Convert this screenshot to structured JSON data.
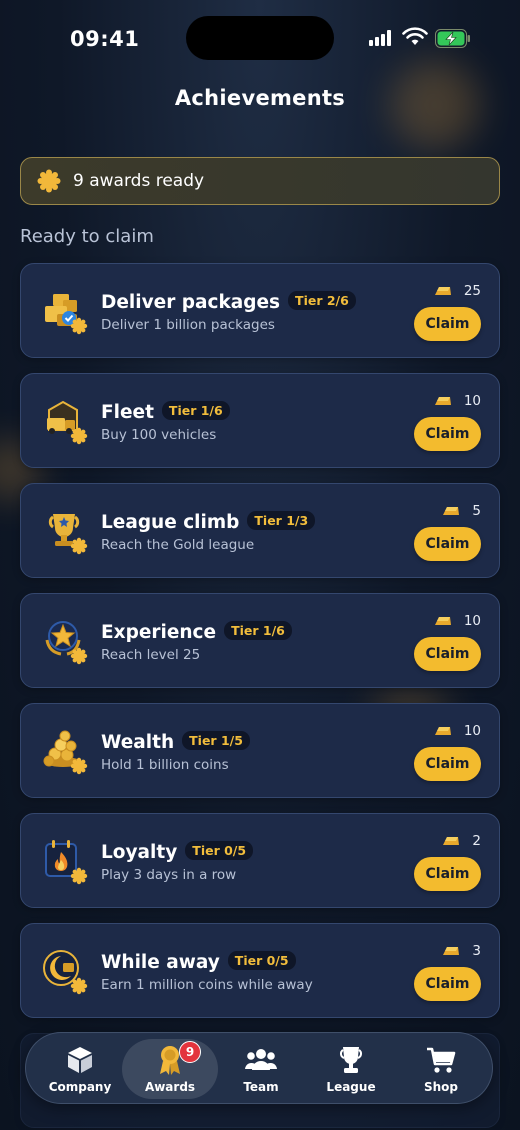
{
  "status_bar": {
    "time": "09:41"
  },
  "header": {
    "title": "Achievements"
  },
  "banner": {
    "text": "9 awards ready"
  },
  "section": {
    "title": "Ready to claim"
  },
  "achievements": [
    {
      "title": "Deliver packages",
      "tier": "Tier 2/6",
      "subtitle": "Deliver 1 billion packages",
      "reward": "25",
      "claim": "Claim",
      "icon": "packages-icon"
    },
    {
      "title": "Fleet",
      "tier": "Tier 1/6",
      "subtitle": "Buy 100 vehicles",
      "reward": "10",
      "claim": "Claim",
      "icon": "truck-icon"
    },
    {
      "title": "League climb",
      "tier": "Tier 1/3",
      "subtitle": "Reach the Gold league",
      "reward": "5",
      "claim": "Claim",
      "icon": "trophy-icon"
    },
    {
      "title": "Experience",
      "tier": "Tier 1/6",
      "subtitle": "Reach level 25",
      "reward": "10",
      "claim": "Claim",
      "icon": "star-icon"
    },
    {
      "title": "Wealth",
      "tier": "Tier 1/5",
      "subtitle": "Hold 1 billion coins",
      "reward": "10",
      "claim": "Claim",
      "icon": "coins-icon"
    },
    {
      "title": "Loyalty",
      "tier": "Tier 0/5",
      "subtitle": "Play 3 days in a row",
      "reward": "2",
      "claim": "Claim",
      "icon": "calendar-flame-icon"
    },
    {
      "title": "While away",
      "tier": "Tier 0/5",
      "subtitle": "Earn 1 million coins while away",
      "reward": "3",
      "claim": "Claim",
      "icon": "moon-coin-icon"
    }
  ],
  "nav": {
    "items": [
      {
        "label": "Company",
        "icon": "box-icon"
      },
      {
        "label": "Awards",
        "icon": "medal-icon",
        "badge": "9",
        "active": true
      },
      {
        "label": "Team",
        "icon": "team-icon"
      },
      {
        "label": "League",
        "icon": "trophy-icon"
      },
      {
        "label": "Shop",
        "icon": "cart-icon"
      }
    ]
  },
  "colors": {
    "accent": "#f3bb2e",
    "card": "#1d2a48",
    "badge_red": "#e3343d"
  }
}
